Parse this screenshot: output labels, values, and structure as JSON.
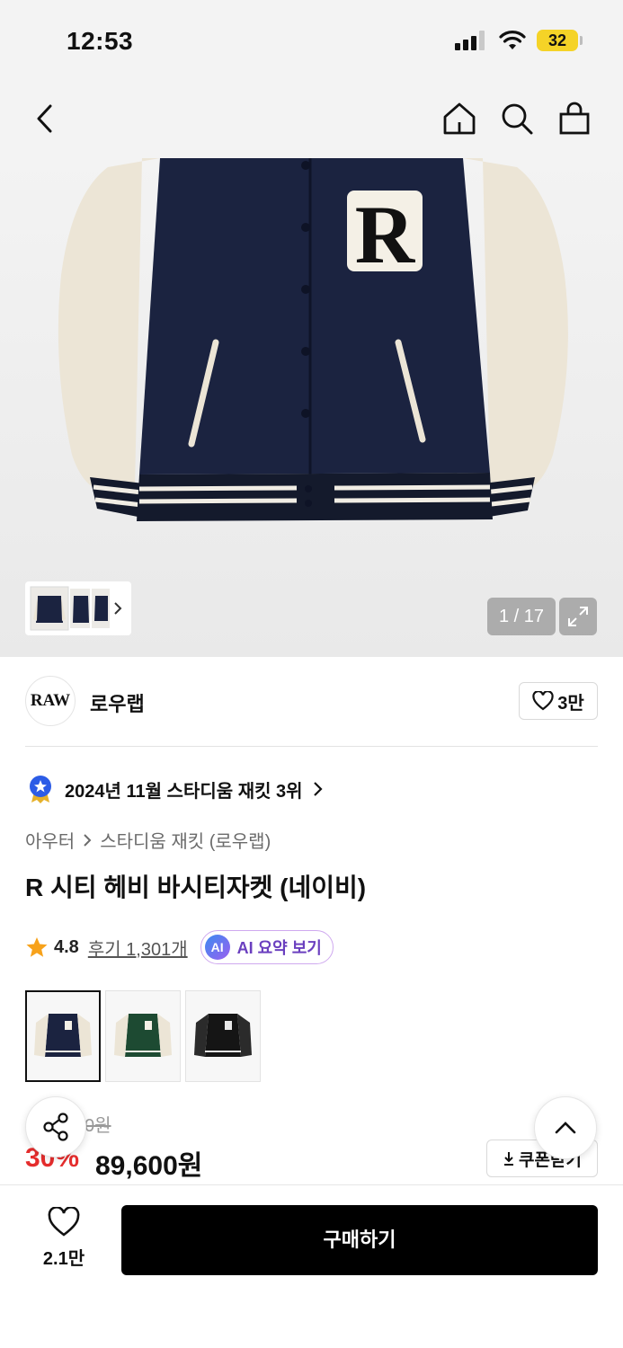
{
  "status_bar": {
    "time": "12:53",
    "battery": "32"
  },
  "nav": {
    "icons": [
      "back-icon",
      "home-icon",
      "search-icon",
      "bag-icon"
    ]
  },
  "gallery": {
    "counter": "1 / 17"
  },
  "brand": {
    "logo_text": "RAW",
    "name": "로우랩",
    "likes": "3만"
  },
  "ranking": {
    "text": "2024년 11월 스타디움 재킷 3위"
  },
  "breadcrumb": {
    "category": "아우터",
    "subcategory": "스타디움 재킷 (로우랩)"
  },
  "product": {
    "title": "R 시티 헤비 바시티자켓 (네이비)"
  },
  "rating": {
    "score": "4.8",
    "reviews": "후기 1,301개",
    "ai_summary": "AI 요약 보기",
    "ai_badge": "AI"
  },
  "colors": [
    "navy",
    "green",
    "black"
  ],
  "price": {
    "original": "0원",
    "discount": "30%",
    "sale": "89,600원",
    "coupon": "쿠폰받기"
  },
  "bottom": {
    "wish_count": "2.1만",
    "buy_label": "구매하기"
  }
}
